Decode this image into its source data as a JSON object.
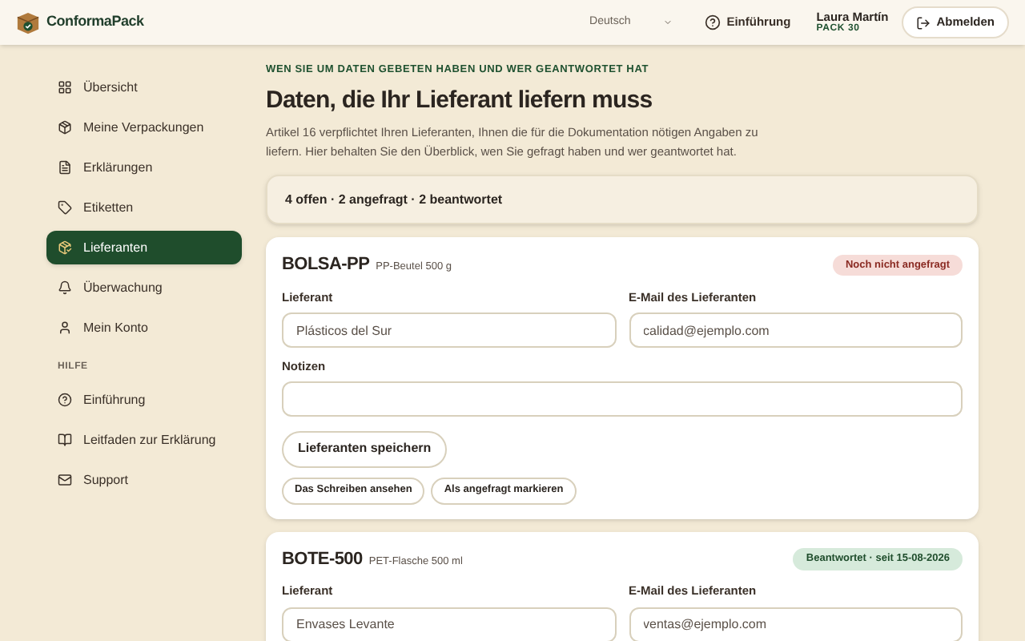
{
  "header": {
    "logo": "ConformaPack",
    "language": "Deutsch",
    "intro": "Einführung",
    "user": {
      "name": "Laura Martín",
      "plan": "PACK 30"
    },
    "logout": "Abmelden"
  },
  "sidebar": {
    "items": [
      {
        "label": "Übersicht",
        "selected": false
      },
      {
        "label": "Meine Verpackungen",
        "selected": false
      },
      {
        "label": "Erklärungen",
        "selected": false
      },
      {
        "label": "Etiketten",
        "selected": false
      },
      {
        "label": "Lieferanten",
        "selected": true
      },
      {
        "label": "Überwachung",
        "selected": false
      },
      {
        "label": "Mein Konto",
        "selected": false
      }
    ],
    "help_heading": "HILFE",
    "help_items": [
      {
        "label": "Einführung"
      },
      {
        "label": "Leitfaden zur Erklärung"
      },
      {
        "label": "Support"
      }
    ]
  },
  "page": {
    "eyebrow": "WEN SIE UM DATEN GEBETEN HABEN UND WER GEANTWORTET HAT",
    "title": "Daten, die Ihr Lieferant liefern muss",
    "intro": "Artikel 16 verpflichtet Ihren Lieferanten, Ihnen die für die Dokumentation nötigen Angaben zu liefern. Hier behalten Sie den Überblick, wen Sie gefragt haben und wer geantwortet hat.",
    "summary": "4 offen · 2 angefragt · 2 beantwortet"
  },
  "suppliers": [
    {
      "code": "BOLSA-PP",
      "description": "PP-Beutel 500 g",
      "status": {
        "kind": "not_requested",
        "label": "Noch nicht angefragt"
      },
      "supplier_label": "Lieferant",
      "supplier": "Plásticos del Sur",
      "email_label": "E-Mail des Lieferanten",
      "email": "calidad@ejemplo.com",
      "notes_label": "Notizen",
      "save": "Lieferanten speichern",
      "actions": [
        "Das Schreiben ansehen",
        "Als angefragt markieren"
      ]
    },
    {
      "code": "BOTE-500",
      "description": "PET-Flasche 500 ml",
      "status": {
        "kind": "answered",
        "label": "Beantwortet · seit 15-08-2026"
      },
      "supplier_label": "Lieferant",
      "supplier": "Envases Levante",
      "email_label": "E-Mail des Lieferanten",
      "email": "ventas@ejemplo.com"
    }
  ]
}
